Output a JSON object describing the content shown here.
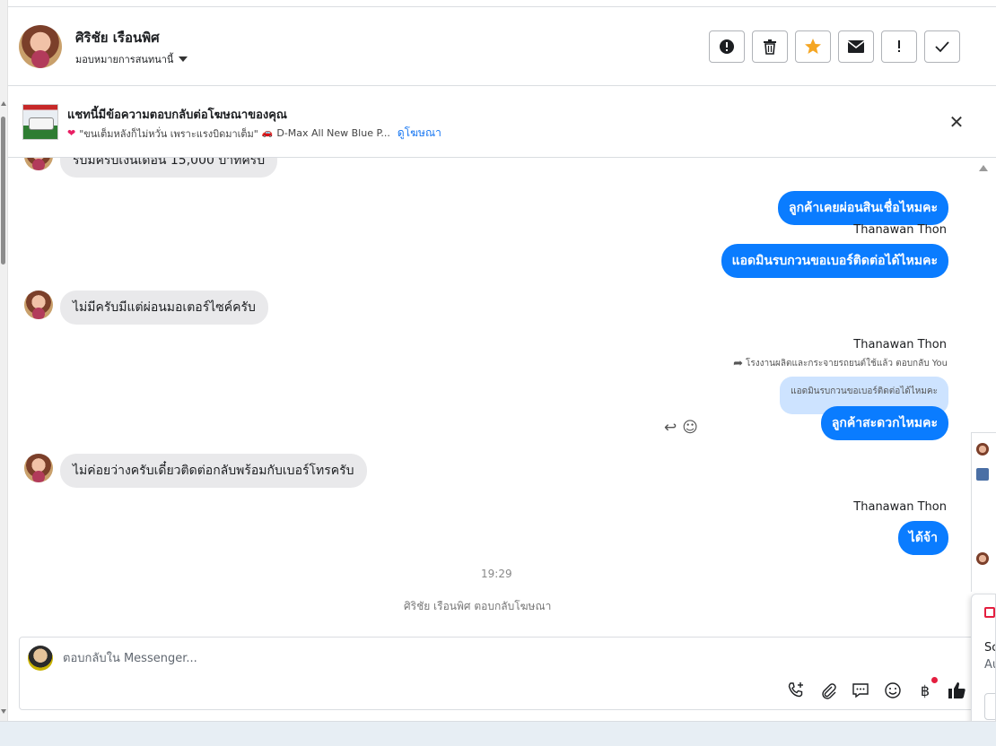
{
  "header": {
    "contact_name": "ศิริชัย เรือนพิศ",
    "assign_label": "มอบหมายการสนทนานี้",
    "action_icons": [
      "spam-icon",
      "trash-icon",
      "star-icon",
      "envelope-icon",
      "exclamation-icon",
      "checkmark-icon"
    ],
    "action_glyphs": [
      "!",
      "🗑",
      "★",
      "✉",
      "!",
      "✓"
    ]
  },
  "ad_banner": {
    "title": "แชทนี้มีข้อความตอบกลับต่อโฆษณาของคุณ",
    "ad_text": "\"ขนเต็มหลังก็ไม่หวั่น เพราะแรงบิดมาเต็ม\"",
    "ad_product": "D-Max All New Blue P...",
    "view_ad_link": "ดูโฆษณา",
    "close_glyph": "✕"
  },
  "messages": {
    "partial_incoming": "รับมีครับเงินเดือน 15,000 บาทครับ",
    "out_1": "ลูกค้าเคยผ่อนสินเชื่อไหมคะ",
    "sender_1": "Thanawan Thon",
    "out_2": "แอดมินรบกวนขอเบอร์ติดต่อได้ไหมคะ",
    "in_1": "ไม่มีครับมีแต่ผ่อนมอเตอร์ไซค์ครับ",
    "sender_2": "Thanawan Thon",
    "reply_note": "โรงงานผลิตและกระจายรถยนต์ใช้แล้ว ตอบกลับ You",
    "quoted_text": "แอดมินรบกวนขอเบอร์ติดต่อได้ไหมคะ",
    "out_3": "ลูกค้าสะดวกไหมคะ",
    "in_2": "ไม่ค่อยว่างครับเดี๋ยวติดต่อกลับพร้อมกับเบอร์โทรครับ",
    "sender_3": "Thanawan Thon",
    "out_4": "ได้จ้า",
    "time": "19:29",
    "system_note": "ศิริชัย เรือนพิศ ตอบกลับโฆษณา"
  },
  "composer": {
    "placeholder": "ตอบกลับใน Messenger...",
    "tools": [
      "phone-plus-icon",
      "paperclip-icon",
      "chat-bubble-icon",
      "emoji-icon",
      "baht-icon",
      "thumbs-up-icon"
    ],
    "tool_glyphs": [
      "☏",
      "⌀",
      "▭",
      "☺",
      "฿",
      "👍"
    ]
  },
  "side_card": {
    "line1": "Sc",
    "line2": "Au"
  }
}
